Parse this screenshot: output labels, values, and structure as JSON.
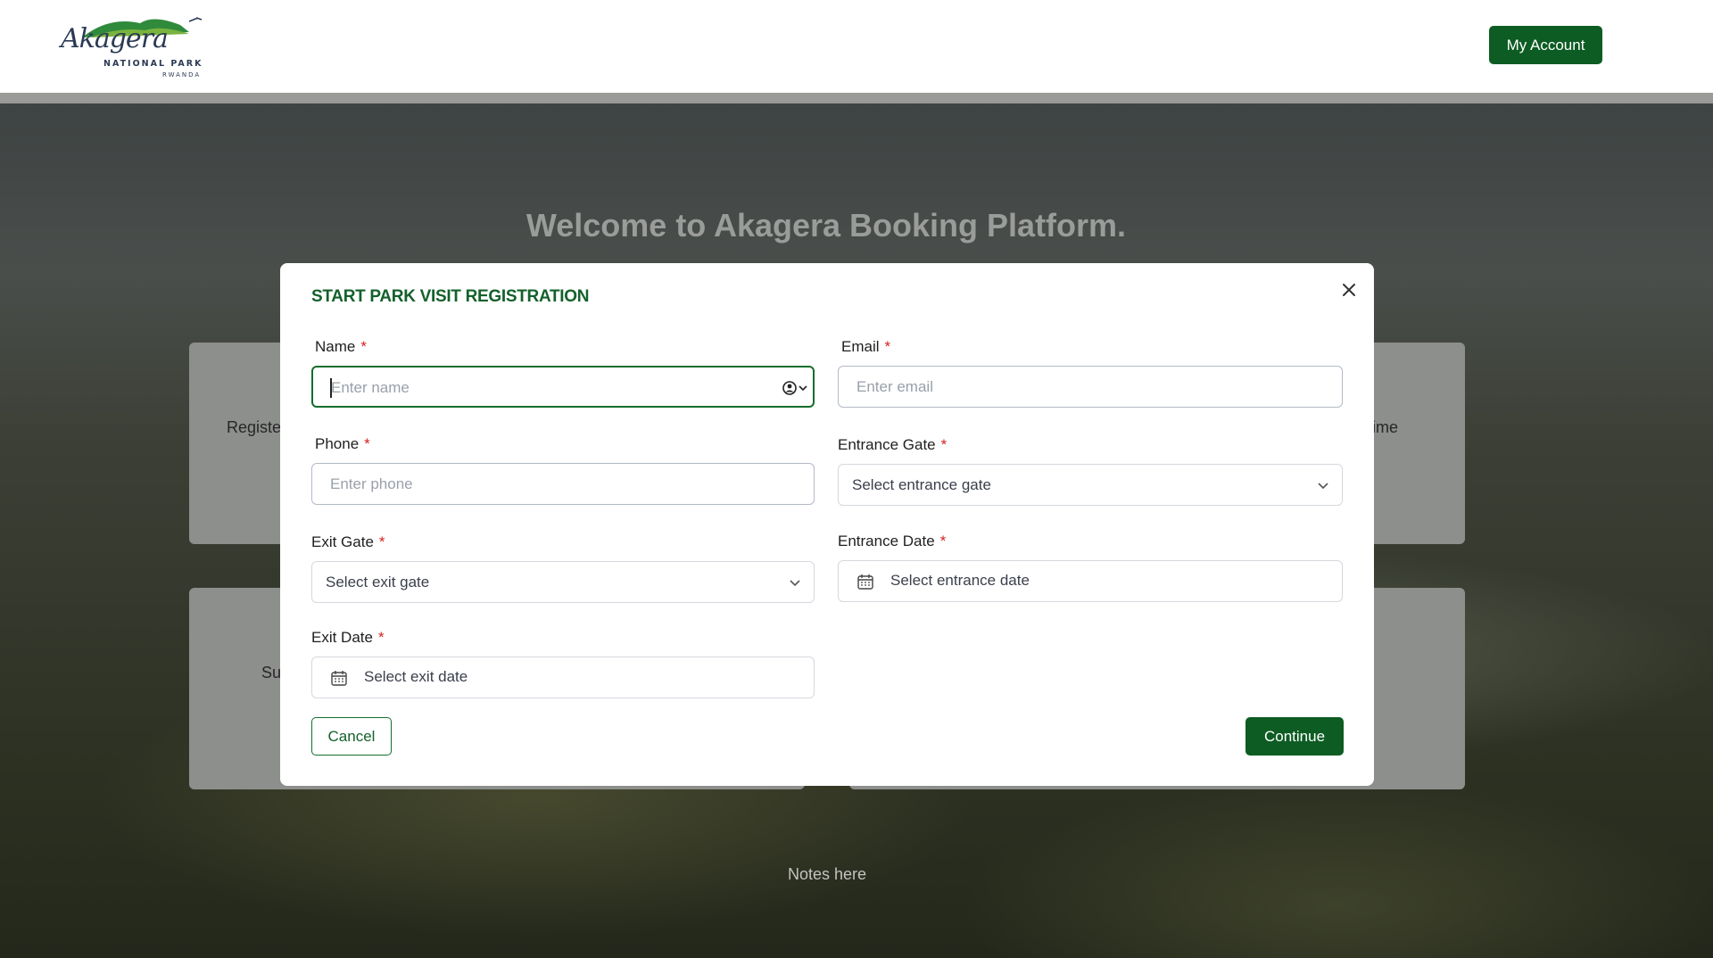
{
  "header": {
    "logo": {
      "script_text": "Akagera",
      "line1": "NATIONAL PARK",
      "line2": "RWANDA"
    },
    "account_button": "My Account",
    "brand_color": "#0d5c23"
  },
  "hero": {
    "title": "Welcome to Akagera Booking Platform.",
    "cards": [
      {
        "visible_text": "Registe"
      },
      {
        "visible_text": "ime"
      },
      {
        "visible_text": "Su"
      },
      {
        "visible_text": ""
      }
    ],
    "notes": "Notes here"
  },
  "modal": {
    "title": "START PARK VISIT REGISTRATION",
    "close_icon": "close-icon",
    "required_marker": "*",
    "fields": {
      "name": {
        "label": "Name",
        "placeholder": "Enter name",
        "value": ""
      },
      "email": {
        "label": "Email",
        "placeholder": "Enter email",
        "value": ""
      },
      "phone": {
        "label": "Phone",
        "placeholder": "Enter phone",
        "value": ""
      },
      "entrance_gate": {
        "label": "Entrance Gate",
        "placeholder": "Select entrance gate"
      },
      "exit_gate": {
        "label": "Exit Gate",
        "placeholder": "Select exit gate"
      },
      "entrance_date": {
        "label": "Entrance Date",
        "placeholder": "Select entrance date"
      },
      "exit_date": {
        "label": "Exit Date",
        "placeholder": "Select exit date"
      }
    },
    "cancel_button": "Cancel",
    "continue_button": "Continue"
  }
}
